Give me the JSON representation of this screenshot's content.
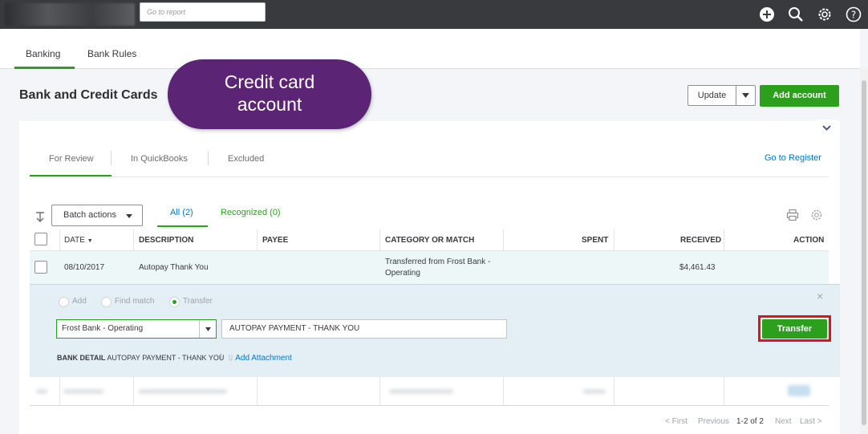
{
  "topbar": {
    "report_placeholder": "Go to report"
  },
  "tabs": [
    {
      "label": "Banking"
    },
    {
      "label": "Bank Rules"
    }
  ],
  "page": {
    "title": "Bank and Credit Cards",
    "update_label": "Update",
    "add_account_label": "Add account"
  },
  "callout": {
    "line1": "Credit card",
    "line2": "account"
  },
  "sub_tabs": [
    {
      "label": "For Review"
    },
    {
      "label": "In QuickBooks"
    },
    {
      "label": "Excluded"
    }
  ],
  "go_to_register": "Go to Register",
  "batch": {
    "label": "Batch actions",
    "filter_all": "All (2)",
    "filter_recognized": "Recognized (0)"
  },
  "table": {
    "headers": {
      "date": "DATE",
      "date_sort": "▼",
      "description": "DESCRIPTION",
      "payee": "PAYEE",
      "category": "CATEGORY OR MATCH",
      "spent": "SPENT",
      "received": "RECEIVED",
      "action": "ACTION"
    },
    "rows": [
      {
        "date": "08/10/2017",
        "description": "Autopay Thank You",
        "payee": "",
        "category_line1": "Transferred from Frost Bank -",
        "category_line2": "Operating",
        "spent": "",
        "received": "$4,461.43"
      }
    ]
  },
  "detail": {
    "radio_add": "Add",
    "radio_find": "Find match",
    "radio_transfer": "Transfer",
    "account_value": "Frost Bank - Operating",
    "memo_value": "AUTOPAY PAYMENT - THANK YOU",
    "transfer_label": "Transfer",
    "bank_detail_label": "BANK DETAIL",
    "bank_detail_value": "AUTOPAY PAYMENT - THANK YOU",
    "separator": "|",
    "add_attachment": "Add Attachment",
    "close": "×"
  },
  "pager": {
    "first": "< First",
    "previous": "Previous",
    "range": "1-2 of 2",
    "next": "Next",
    "last": "Last >"
  },
  "colors": {
    "accent_green": "#2ca01c",
    "link_blue": "#0077c5",
    "callout_purple": "#5b2474",
    "highlight_red": "#e2121b",
    "topbar": "#393a3d"
  }
}
